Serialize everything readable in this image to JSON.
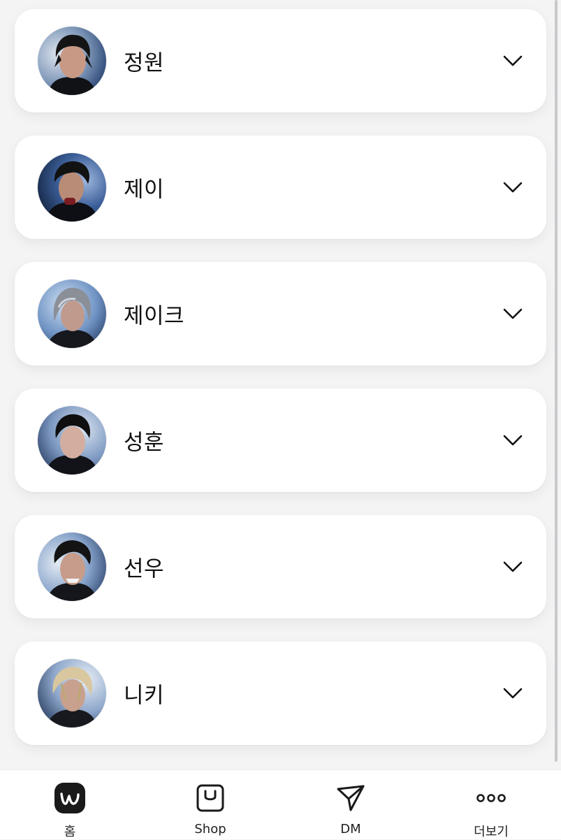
{
  "members": [
    {
      "name": "정원",
      "avatar_icon": "member-photo-avatar"
    },
    {
      "name": "제이",
      "avatar_icon": "member-photo-avatar"
    },
    {
      "name": "제이크",
      "avatar_icon": "member-photo-avatar"
    },
    {
      "name": "성훈",
      "avatar_icon": "member-photo-avatar"
    },
    {
      "name": "선우",
      "avatar_icon": "member-photo-avatar"
    },
    {
      "name": "니키",
      "avatar_icon": "member-photo-avatar"
    }
  ],
  "expand_icon": "chevron-down-icon",
  "tabbar": {
    "home_label": "홈",
    "shop_label": "Shop",
    "dm_label": "DM",
    "more_label": "더보기"
  },
  "colors": {
    "background": "#f4f4f5",
    "card": "#ffffff",
    "home_icon_bg": "#1a1a1a",
    "text": "#111111"
  }
}
